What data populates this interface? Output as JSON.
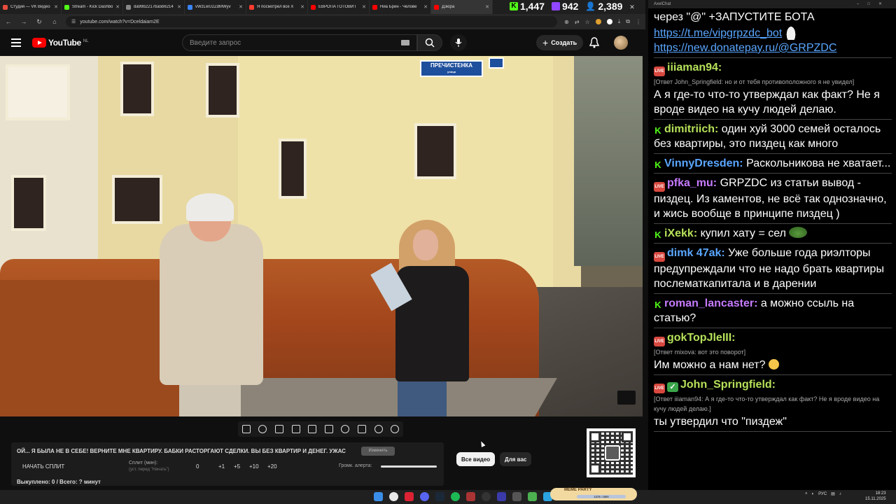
{
  "browser": {
    "tabs": [
      {
        "label": "Студия — VK Видео",
        "color": "#e74c3c",
        "active": false
      },
      {
        "label": "Stream - Kick Dashboard",
        "color": "#53fc18",
        "active": false
      },
      {
        "label": "da99b2217ba5b6214",
        "color": "#888888",
        "active": false
      },
      {
        "label": "vWzLwU2ZdMWyv",
        "color": "#3a86ff",
        "active": false
      },
      {
        "label": "Я посмотрел все Х",
        "color": "#ff3b30",
        "active": false
      },
      {
        "label": "ЕВРОПА ГОТОВИТ",
        "color": "#ff0000",
        "active": false
      },
      {
        "label": "Ниа Брин - Челове",
        "color": "#ff0000",
        "active": false
      },
      {
        "label": "Дзюра",
        "color": "#ff0000",
        "active": true
      }
    ],
    "url": "youtube.com/watch?v=Dceldaiam2E",
    "stats": {
      "kick_viewers": "1,447",
      "twitch_viewers": "942",
      "total_viewers": "2,389"
    }
  },
  "youtube": {
    "logo_text": "YouTube",
    "logo_region": "NL",
    "search_placeholder": "Введите запрос",
    "create_label": "Создать"
  },
  "video": {
    "street_sign": "ПРЕЧИСТЕНКА",
    "street_sign_sub": "улица"
  },
  "alert_panel": {
    "title": "ОЙ... Я БЫЛА НЕ В СЕБЕ! ВЕРНИТЕ МНЕ КВАРТИРУ. БАБКИ РАСТОРГАЮТ СДЕЛКИ. ВЫ БЕЗ КВАРТИР И ДЕНЕГ. УЖАС",
    "edit_label": "Изменить",
    "split_button": "НАЧАТЬ СПЛИТ",
    "split_label": "Сплит (мин):",
    "split_hint": "(уст. перед \"Начать\")",
    "split_values": [
      "0",
      "+1",
      "+5",
      "+10",
      "+20"
    ],
    "volume_label": "Громк. алерта:",
    "bought": "Выкуплено: 0 / Всего: ? минут"
  },
  "chips": {
    "all_videos": "Все видео",
    "for_you": "Для вас"
  },
  "chat": {
    "window_title": "AxelChat",
    "top_text": "через \"@\" +ЗАПУСТИТЕ БОТА",
    "link1": "https://t.me/vipgrpzdc_bot",
    "link2": "https://new.donatepay.ru/@GRPZDC",
    "messages": [
      {
        "badge": "live",
        "user": "iiiaman94:",
        "color": "#b6e15a",
        "reply": "[Ответ John_Springfield: но и от тебя противоположного я не увидел]",
        "text": "А я где-то что-то утверждал как факт? Не я вроде видео на кучу людей делаю."
      },
      {
        "badge": "kick",
        "user": "dimitriich:",
        "color": "#b6e15a",
        "reply": "",
        "text": " один хуй 3000 семей осталось без квартиры, это пиздец как много"
      },
      {
        "badge": "kick",
        "user": "VinnyDresden:",
        "color": "#5aa6ff",
        "reply": "",
        "text": " Раскольникова не хватает..."
      },
      {
        "badge": "live",
        "user": "pfka_mu:",
        "color": "#c67bff",
        "reply": "",
        "text": " GRPZDC из статьи вывод - пиздец. Из каментов, не всё так однозначно, и жись вообще в принципе пиздец )"
      },
      {
        "badge": "kick",
        "user": "iXekk:",
        "color": "#b6e15a",
        "reply": "",
        "text": " купил хату = сел"
      },
      {
        "badge": "live",
        "user": "dimk 47ak:",
        "color": "#5aa6ff",
        "reply": "",
        "text": " Уже больше года риэлторы предупреждали что не надо брать квартиры послематкапитала и в дарении"
      },
      {
        "badge": "kick",
        "user": "roman_lancaster:",
        "color": "#c67bff",
        "reply": "",
        "text": " а можно ссыль на статью?"
      },
      {
        "badge": "live",
        "user": "gokTopJleIII:",
        "color": "#b6e15a",
        "reply": "[Ответ mixova: вот это поворот]",
        "text": "Им можно а нам нет?"
      },
      {
        "badge": "live",
        "user": "John_Springfield:",
        "color": "#b6e15a",
        "reply": "[Ответ iiiaman94: А я где-то что-то утверждал как факт? Не я вроде видео на кучу людей делаю.]",
        "text": "ты утвердил что \"пиздеж\""
      }
    ]
  },
  "taskbar": {
    "meme_party": "MEME PARTY",
    "meme_progress": "1375 / 1500",
    "lang": "РУС",
    "time": "18:23",
    "date": "15.11.2025"
  }
}
